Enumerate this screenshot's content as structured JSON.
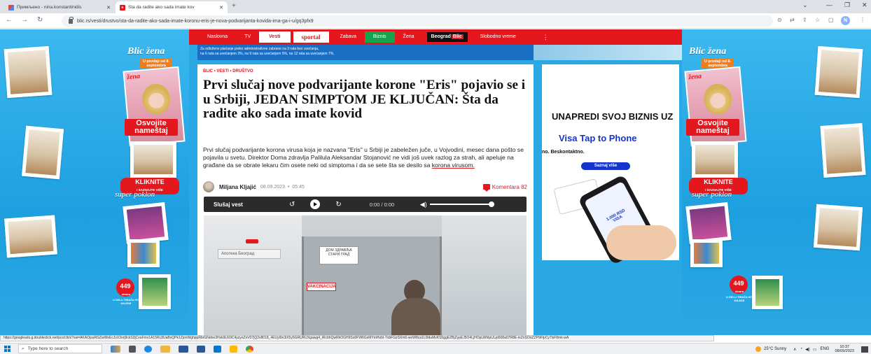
{
  "browser": {
    "tabs": [
      {
        "title": "Примљено - nina.konstantinidis",
        "active": false
      },
      {
        "title": "Šta da radite ako sada imate kov",
        "active": true
      }
    ],
    "new_tab": "+",
    "url": "blic.rs/vesti/drustvo/sta-da-radite-ako-sada-imate-koronu-eris-je-nova-podvarijanta-kovida-ima-ga-i-u/gq3pfx9",
    "profile_initial": "N",
    "window_controls": {
      "minimize": "—",
      "restore": "❐",
      "close": "✕"
    }
  },
  "site_nav": {
    "items": [
      "Naslovna",
      "TV",
      "Vesti",
      "sportal",
      "Zabava",
      "Biznis",
      "Žena"
    ],
    "beograd": "Beograd",
    "beograd_blic": "Blic",
    "extra": "Slobodno vreme",
    "more": "⋮",
    "active": "Vesti"
  },
  "top_banner": {
    "line1": "Za odloženo plaćanje preko administrativne zabrane na 3 rata bez uvećanja,",
    "line2": "na 6 rata sa uvećanjem 3%, na 9 rata sa uvećanjem 5%, na 12 rata sa uvećanjem 7%."
  },
  "article": {
    "category": "BLIC • VESTI • DRUŠTVO",
    "headline": "Prvi slučaj nove podvarijante korone \"Eris\" pojavio se i u Srbiji, JEDAN SIMPTOM JE KLJUČAN: Šta da radite ako sada imate kovid",
    "lead_text": "Prvi slučaj podvarijante korona virusa koja je nazvana \"Eris\" u Srbiji je zabeležen juče, u Vojvodini, mesec dana pošto se pojavila u svetu. Direktor Doma zdravlja Palilula Aleksandar Stojanović ne vidi još uvek razlog za strah, ali apeluje na građane da se obrate lekaru čim osete neki od simptoma i da se sete šta se desilo sa",
    "lead_link": "korona virusom.",
    "author": "Miljana Kljajić",
    "date": "08.09.2023",
    "time": "05:45",
    "comments": "Komentara 82",
    "player": {
      "label": "Slušaj vest",
      "time": "0:00 / 0:00"
    },
    "photo_texts": {
      "pharmacy": "Апотека Београд",
      "door_sign": "ДОМ ЗДРАВЉА СТАРИ ГРАД",
      "vakcinacija": "VAKCINACIJA"
    }
  },
  "visa_ad": {
    "headline": "UNAPREDI SVOJ BIZNIS UZ",
    "brand_line": "Visa Tap to Phone",
    "subline": "no. Beskontaktno.",
    "button": "Saznaj više",
    "screen_amount": "1.000 RSD",
    "screen_brand": "VISA"
  },
  "side_ads": {
    "left": {
      "brand": "Blic žena",
      "sale": "U prodaji od 8. septembra",
      "cover_brand": "žena",
      "osvojite": "Osvojite nameštaj",
      "kliknite": "KLIKNITE",
      "saznajte": "I SAZNAJTE VIŠE",
      "poklon": "super poklon",
      "price": "449",
      "price_unit": "dinara",
      "bottom": "U DELU TIRAŽA HIT KNJIGE"
    },
    "right": {
      "brand": "Blic žena",
      "sale": "U prodaji od 8. septembra",
      "cover_brand": "žena",
      "osvojite": "Osvojite nameštaj",
      "kliknite": "KLIKNITE",
      "saznajte": "I SAZNAJTE VIŠE",
      "poklon": "super poklon",
      "price": "449",
      "price_unit": "dinara",
      "bottom": "U DELU TIRAŽA HIT KNJIGE"
    }
  },
  "status_url": "https://googleads.g.doubleclick.net/pcs/click?xai=AKAOjsuRGZarMxEcJvX3orj9ckS3jCvuFmv1A15RL8UaBxQPk1ZjonWghppRbrGNdne3Hxk9L60iC4yzyoZoV07jQ2v8018_4EUyl0n3iX5y5GRURUXgawg4_iRcbhQwRkOGH9So0FW6GxMYmHobl-TxbFGzSXm6-woW8ca1L0lduMvKS5ggEZBjZypEJ5O4LjHOpLWhlpULpt608a07R8E-inZnSOoZZP9FlpCy7lsF8mk-wA",
  "taskbar": {
    "search_placeholder": "Type here to search",
    "weather": "25°C  Sunny",
    "lang": "ENG",
    "time": "10:37",
    "date": "08/09/2023"
  }
}
